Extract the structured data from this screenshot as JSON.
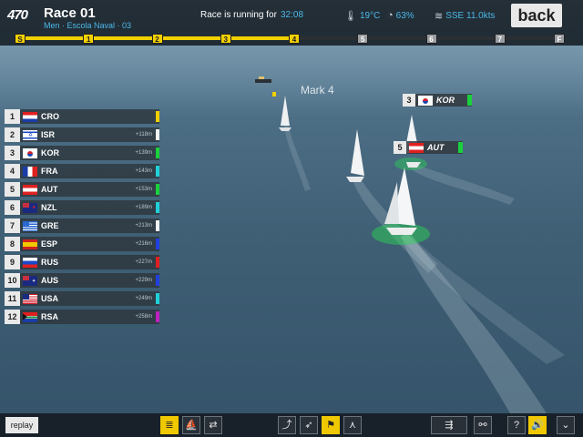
{
  "header": {
    "logo": "470",
    "race_title": "Race 01",
    "race_subtitle": "Men · Escola Naval · 03",
    "running_label": "Race is running for",
    "running_time": "32:08",
    "temperature": "19°C",
    "humidity": "63%",
    "wind": "SSE 11.0kts",
    "back_label": "back"
  },
  "progress": {
    "marks": [
      "S",
      "1",
      "2",
      "3",
      "4",
      "5",
      "6",
      "7",
      "F"
    ],
    "completed_marks": 5,
    "active_color": "#f2d000",
    "inactive_color": "#2b2f33"
  },
  "course": {
    "mark_label": "Mark 4"
  },
  "leaderboard": [
    {
      "pos": "1",
      "code": "CRO",
      "gap": "",
      "color": "#f2d000",
      "flag": "cro"
    },
    {
      "pos": "2",
      "code": "ISR",
      "gap": "+118m",
      "color": "#f2f2f2",
      "flag": "isr"
    },
    {
      "pos": "3",
      "code": "KOR",
      "gap": "+139m",
      "color": "#1ad03c",
      "flag": "kor"
    },
    {
      "pos": "4",
      "code": "FRA",
      "gap": "+143m",
      "color": "#20d0d8",
      "flag": "fra"
    },
    {
      "pos": "5",
      "code": "AUT",
      "gap": "+153m",
      "color": "#1ad03c",
      "flag": "aut"
    },
    {
      "pos": "6",
      "code": "NZL",
      "gap": "+189m",
      "color": "#20d0d8",
      "flag": "nzl"
    },
    {
      "pos": "7",
      "code": "GRE",
      "gap": "+213m",
      "color": "#f2f2f2",
      "flag": "gre"
    },
    {
      "pos": "8",
      "code": "ESP",
      "gap": "+216m",
      "color": "#2040e0",
      "flag": "esp"
    },
    {
      "pos": "9",
      "code": "RUS",
      "gap": "+227m",
      "color": "#e02020",
      "flag": "rus"
    },
    {
      "pos": "10",
      "code": "AUS",
      "gap": "+229m",
      "color": "#2040e0",
      "flag": "aus"
    },
    {
      "pos": "11",
      "code": "USA",
      "gap": "+249m",
      "color": "#20d0d8",
      "flag": "usa"
    },
    {
      "pos": "12",
      "code": "RSA",
      "gap": "+258m",
      "color": "#c020c0",
      "flag": "rsa"
    }
  ],
  "boat_tags": [
    {
      "pos": "3",
      "code": "KOR",
      "flag": "kor"
    },
    {
      "pos": "5",
      "code": "AUT",
      "flag": "aut"
    }
  ],
  "footer": {
    "replay_label": "replay",
    "tools": [
      {
        "name": "leaderboard-toggle",
        "icon": "list-icon",
        "glyph": "≣",
        "on": true
      },
      {
        "name": "boat-info",
        "icon": "boat-info-icon",
        "glyph": "⛵",
        "on": false
      },
      {
        "name": "boat-compare",
        "icon": "boat-compare-icon",
        "glyph": "⇄",
        "on": false
      },
      {
        "name": "course-view",
        "icon": "course-icon",
        "glyph": "⤴",
        "on": false
      },
      {
        "name": "wind-view",
        "icon": "wind-icon",
        "glyph": "➶",
        "on": false
      },
      {
        "name": "windsock-view",
        "icon": "windsock-icon",
        "glyph": "⚑",
        "on": true
      },
      {
        "name": "marks-view",
        "icon": "marks-icon",
        "glyph": "⋏",
        "on": false
      },
      {
        "name": "follow-boat",
        "icon": "follow-boat-icon",
        "glyph": "⇶",
        "on": false
      },
      {
        "name": "binoculars",
        "icon": "binoculars-icon",
        "glyph": "⚯",
        "on": false
      },
      {
        "name": "help",
        "icon": "help-icon",
        "glyph": "?",
        "on": false
      },
      {
        "name": "sound",
        "icon": "speaker-icon",
        "glyph": "🔊",
        "on": true
      },
      {
        "name": "collapse",
        "icon": "chevron-down-icon",
        "glyph": "⌄",
        "on": false
      }
    ]
  }
}
